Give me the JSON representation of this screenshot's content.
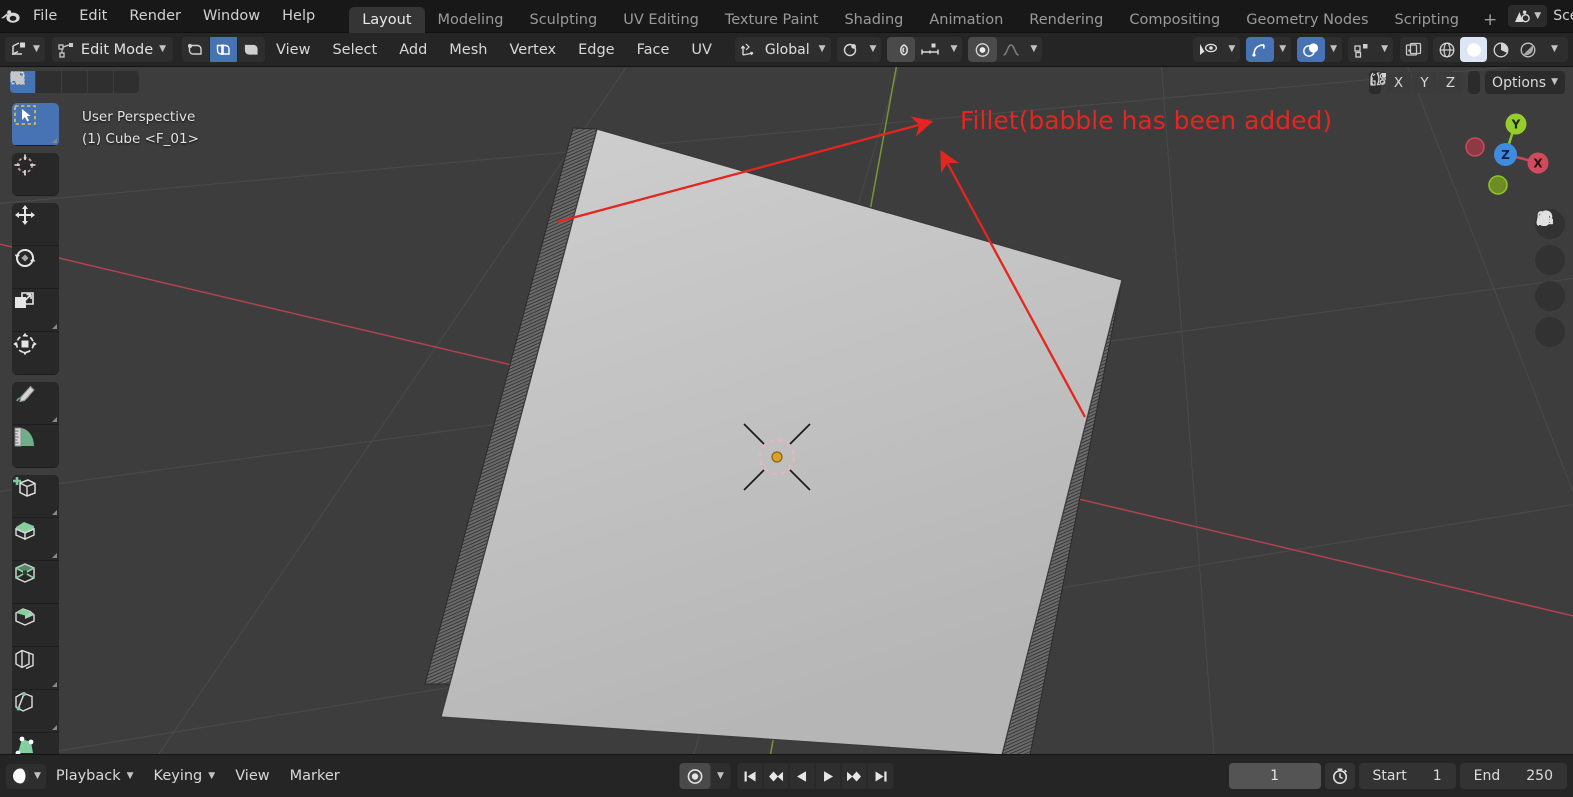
{
  "app": {
    "name": "Blender",
    "logo_icon": "blender-logo-icon"
  },
  "topbar": {
    "menus": [
      {
        "label": "File",
        "name": "menu-file"
      },
      {
        "label": "Edit",
        "name": "menu-edit"
      },
      {
        "label": "Render",
        "name": "menu-render"
      },
      {
        "label": "Window",
        "name": "menu-window"
      },
      {
        "label": "Help",
        "name": "menu-help"
      }
    ],
    "workspace_tabs": [
      {
        "label": "Layout",
        "active": true
      },
      {
        "label": "Modeling",
        "active": false
      },
      {
        "label": "Sculpting",
        "active": false
      },
      {
        "label": "UV Editing",
        "active": false
      },
      {
        "label": "Texture Paint",
        "active": false
      },
      {
        "label": "Shading",
        "active": false
      },
      {
        "label": "Animation",
        "active": false
      },
      {
        "label": "Rendering",
        "active": false
      },
      {
        "label": "Compositing",
        "active": false
      },
      {
        "label": "Geometry Nodes",
        "active": false
      },
      {
        "label": "Scripting",
        "active": false
      }
    ],
    "add_workspace_label": "+",
    "scene_icon": "scene-icon",
    "scene_name": "Sce"
  },
  "viewport_header": {
    "editor_type_icon": "editor-type-3dview-icon",
    "mode": "Edit Mode",
    "mesh_select_modes": [
      {
        "name": "vertex-select-mode",
        "icon": "vertex-select-icon",
        "active": false
      },
      {
        "name": "edge-select-mode",
        "icon": "edge-select-icon",
        "active": true
      },
      {
        "name": "face-select-mode",
        "icon": "face-select-icon",
        "active": false
      }
    ],
    "menus": [
      {
        "label": "View",
        "name": "viewport-menu-view"
      },
      {
        "label": "Select",
        "name": "viewport-menu-select"
      },
      {
        "label": "Add",
        "name": "viewport-menu-add"
      },
      {
        "label": "Mesh",
        "name": "viewport-menu-mesh"
      },
      {
        "label": "Vertex",
        "name": "viewport-menu-vertex"
      },
      {
        "label": "Edge",
        "name": "viewport-menu-edge"
      },
      {
        "label": "Face",
        "name": "viewport-menu-face"
      },
      {
        "label": "UV",
        "name": "viewport-menu-uv"
      }
    ],
    "transform_orientation": "Global",
    "pivot_icon": "pivot-point-icon",
    "snap_magnet_icon": "snap-magnet-icon",
    "snap_target_icon": "snap-increment-icon",
    "proportional_edit_icon": "proportional-editing-icon",
    "proportional_falloff_icon": "falloff-curve-icon",
    "visibility_icon": "object-visibility-icon",
    "gizmo_icon": "gizmo-icon",
    "overlays_icon": "overlays-icon",
    "xray_icon": "xray-toggle-icon",
    "shading_modes": [
      {
        "name": "shading-wireframe",
        "icon": "wireframe-icon",
        "active": false
      },
      {
        "name": "shading-solid",
        "icon": "solid-sphere-icon",
        "active": true
      },
      {
        "name": "shading-material",
        "icon": "material-preview-icon",
        "active": false
      },
      {
        "name": "shading-rendered",
        "icon": "rendered-icon",
        "active": false
      }
    ]
  },
  "viewport": {
    "select_tool_modes": [
      {
        "name": "select-box",
        "icon": "select-box-icon",
        "active": true
      },
      {
        "name": "select-extend",
        "icon": "select-extend-icon",
        "active": false
      },
      {
        "name": "select-subtract",
        "icon": "select-subtract-icon",
        "active": false
      },
      {
        "name": "select-invert",
        "icon": "select-invert-icon",
        "active": false
      },
      {
        "name": "select-intersect",
        "icon": "select-intersect-icon",
        "active": false
      }
    ],
    "info_line_1": "User Perspective",
    "info_line_2": "(1) Cube <F_01>",
    "snap_cursor_icon": "snap-cursor-icon",
    "axis_locks": [
      "X",
      "Y",
      "Z"
    ],
    "mirror_icon": "mirror-options-icon",
    "options_label": "Options",
    "nav_gizmo_axes": [
      {
        "label": "X",
        "color": "#e05a6b"
      },
      {
        "label": "Y",
        "color": "#9ccc2a"
      },
      {
        "label": "Z",
        "color": "#3d8ce0"
      }
    ],
    "nav_buttons": [
      {
        "name": "zoom-view-button",
        "icon": "magnifier-plus-icon"
      },
      {
        "name": "pan-view-button",
        "icon": "hand-icon"
      },
      {
        "name": "camera-view-button",
        "icon": "camera-icon"
      },
      {
        "name": "toggle-ortho-button",
        "icon": "grid-perspective-icon"
      }
    ],
    "tools": [
      {
        "name": "tool-tweak",
        "icon": "cursor-select-box-icon",
        "active": true,
        "corner": true
      },
      {
        "name": "tool-cursor",
        "icon": "3d-cursor-icon",
        "active": false,
        "corner": false
      },
      {
        "name": "tool-move",
        "icon": "move-arrows-icon",
        "active": false,
        "corner": false
      },
      {
        "name": "tool-rotate",
        "icon": "rotate-icon",
        "active": false,
        "corner": false
      },
      {
        "name": "tool-scale",
        "icon": "scale-icon",
        "active": false,
        "corner": true
      },
      {
        "name": "tool-transform",
        "icon": "transform-icon",
        "active": false,
        "corner": false
      },
      {
        "name": "tool-annotate",
        "icon": "pencil-annotate-icon",
        "active": false,
        "corner": true
      },
      {
        "name": "tool-measure",
        "icon": "ruler-measure-icon",
        "active": false,
        "corner": false
      },
      {
        "name": "tool-add-cube",
        "icon": "add-cube-icon",
        "active": false,
        "corner": true
      },
      {
        "name": "tool-extrude",
        "icon": "extrude-region-icon",
        "active": false,
        "corner": true
      },
      {
        "name": "tool-inset-faces",
        "icon": "inset-faces-icon",
        "active": false,
        "corner": false
      },
      {
        "name": "tool-bevel",
        "icon": "bevel-icon",
        "active": false,
        "corner": false
      },
      {
        "name": "tool-loop-cut",
        "icon": "loop-cut-icon",
        "active": false,
        "corner": true
      },
      {
        "name": "tool-knife",
        "icon": "knife-icon",
        "active": false,
        "corner": true
      },
      {
        "name": "tool-poly-build",
        "icon": "poly-build-icon",
        "active": false,
        "corner": false
      }
    ],
    "annotation": {
      "text": "Fillet(babble has been added)",
      "color": "#e5251f",
      "arrow_color": "#e5251f"
    },
    "cursor_3d_icon": "3d-cursor-crosshair-icon",
    "colors": {
      "background": "#3d3d3d",
      "object_face": "#c2c2c2",
      "grid_line": "#4a4a4a",
      "axis_x_line": "#b34a52",
      "axis_y_line": "#7a9a3a"
    }
  },
  "timeline": {
    "editor_icon": "timeline-editor-icon",
    "menus": [
      {
        "label": "Playback",
        "has_chevron": true,
        "name": "timeline-menu-playback"
      },
      {
        "label": "Keying",
        "has_chevron": true,
        "name": "timeline-menu-keying"
      },
      {
        "label": "View",
        "has_chevron": false,
        "name": "timeline-menu-view"
      },
      {
        "label": "Marker",
        "has_chevron": false,
        "name": "timeline-menu-marker"
      }
    ],
    "auto_key_icon": "record-auto-keyframe-icon",
    "transport": [
      {
        "name": "jump-to-start-button",
        "icon": "jump-start-icon"
      },
      {
        "name": "prev-keyframe-button",
        "icon": "prev-keyframe-icon"
      },
      {
        "name": "play-reverse-button",
        "icon": "play-reverse-icon"
      },
      {
        "name": "play-button",
        "icon": "play-icon"
      },
      {
        "name": "next-keyframe-button",
        "icon": "next-keyframe-icon"
      },
      {
        "name": "jump-to-end-button",
        "icon": "jump-end-icon"
      }
    ],
    "current_frame": "1",
    "clock_icon": "stopwatch-icon",
    "start_label": "Start",
    "start_value": "1",
    "end_label": "End",
    "end_value": "250"
  }
}
